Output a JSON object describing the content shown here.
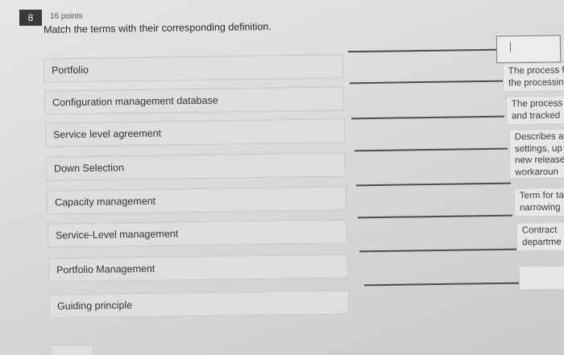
{
  "question": {
    "number": "8",
    "points": "16 points",
    "prompt": "Match the terms with their corresponding definition."
  },
  "terms": [
    "Portfolio",
    "Configuration management database",
    "Service level agreement",
    "Down Selection",
    "Capacity management",
    "Service-Level management",
    "Portfolio Management",
    "Guiding principle"
  ],
  "definitions": [
    {
      "lines": []
    },
    {
      "lines": [
        "The process f",
        "the processin"
      ]
    },
    {
      "lines": [
        "The process",
        "and tracked"
      ]
    },
    {
      "lines": [
        "Describes a",
        "settings, up",
        "new release",
        "workaroun"
      ]
    },
    {
      "lines": [
        "Term for ta",
        "narrowing"
      ]
    },
    {
      "lines": [
        "Contract",
        "departme"
      ]
    },
    {
      "lines": []
    }
  ]
}
